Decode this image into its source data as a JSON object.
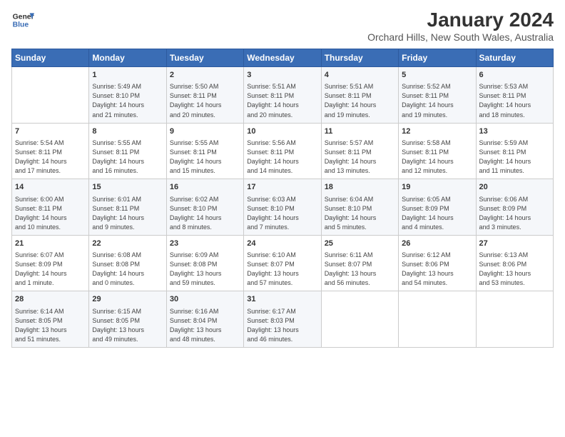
{
  "logo": {
    "line1": "General",
    "line2": "Blue"
  },
  "title": "January 2024",
  "subtitle": "Orchard Hills, New South Wales, Australia",
  "colors": {
    "header_bg": "#3a6db5",
    "header_text": "#ffffff"
  },
  "days_of_week": [
    "Sunday",
    "Monday",
    "Tuesday",
    "Wednesday",
    "Thursday",
    "Friday",
    "Saturday"
  ],
  "weeks": [
    [
      {
        "day": "",
        "content": ""
      },
      {
        "day": "1",
        "content": "Sunrise: 5:49 AM\nSunset: 8:10 PM\nDaylight: 14 hours\nand 21 minutes."
      },
      {
        "day": "2",
        "content": "Sunrise: 5:50 AM\nSunset: 8:11 PM\nDaylight: 14 hours\nand 20 minutes."
      },
      {
        "day": "3",
        "content": "Sunrise: 5:51 AM\nSunset: 8:11 PM\nDaylight: 14 hours\nand 20 minutes."
      },
      {
        "day": "4",
        "content": "Sunrise: 5:51 AM\nSunset: 8:11 PM\nDaylight: 14 hours\nand 19 minutes."
      },
      {
        "day": "5",
        "content": "Sunrise: 5:52 AM\nSunset: 8:11 PM\nDaylight: 14 hours\nand 19 minutes."
      },
      {
        "day": "6",
        "content": "Sunrise: 5:53 AM\nSunset: 8:11 PM\nDaylight: 14 hours\nand 18 minutes."
      }
    ],
    [
      {
        "day": "7",
        "content": "Sunrise: 5:54 AM\nSunset: 8:11 PM\nDaylight: 14 hours\nand 17 minutes."
      },
      {
        "day": "8",
        "content": "Sunrise: 5:55 AM\nSunset: 8:11 PM\nDaylight: 14 hours\nand 16 minutes."
      },
      {
        "day": "9",
        "content": "Sunrise: 5:55 AM\nSunset: 8:11 PM\nDaylight: 14 hours\nand 15 minutes."
      },
      {
        "day": "10",
        "content": "Sunrise: 5:56 AM\nSunset: 8:11 PM\nDaylight: 14 hours\nand 14 minutes."
      },
      {
        "day": "11",
        "content": "Sunrise: 5:57 AM\nSunset: 8:11 PM\nDaylight: 14 hours\nand 13 minutes."
      },
      {
        "day": "12",
        "content": "Sunrise: 5:58 AM\nSunset: 8:11 PM\nDaylight: 14 hours\nand 12 minutes."
      },
      {
        "day": "13",
        "content": "Sunrise: 5:59 AM\nSunset: 8:11 PM\nDaylight: 14 hours\nand 11 minutes."
      }
    ],
    [
      {
        "day": "14",
        "content": "Sunrise: 6:00 AM\nSunset: 8:11 PM\nDaylight: 14 hours\nand 10 minutes."
      },
      {
        "day": "15",
        "content": "Sunrise: 6:01 AM\nSunset: 8:11 PM\nDaylight: 14 hours\nand 9 minutes."
      },
      {
        "day": "16",
        "content": "Sunrise: 6:02 AM\nSunset: 8:10 PM\nDaylight: 14 hours\nand 8 minutes."
      },
      {
        "day": "17",
        "content": "Sunrise: 6:03 AM\nSunset: 8:10 PM\nDaylight: 14 hours\nand 7 minutes."
      },
      {
        "day": "18",
        "content": "Sunrise: 6:04 AM\nSunset: 8:10 PM\nDaylight: 14 hours\nand 5 minutes."
      },
      {
        "day": "19",
        "content": "Sunrise: 6:05 AM\nSunset: 8:09 PM\nDaylight: 14 hours\nand 4 minutes."
      },
      {
        "day": "20",
        "content": "Sunrise: 6:06 AM\nSunset: 8:09 PM\nDaylight: 14 hours\nand 3 minutes."
      }
    ],
    [
      {
        "day": "21",
        "content": "Sunrise: 6:07 AM\nSunset: 8:09 PM\nDaylight: 14 hours\nand 1 minute."
      },
      {
        "day": "22",
        "content": "Sunrise: 6:08 AM\nSunset: 8:08 PM\nDaylight: 14 hours\nand 0 minutes."
      },
      {
        "day": "23",
        "content": "Sunrise: 6:09 AM\nSunset: 8:08 PM\nDaylight: 13 hours\nand 59 minutes."
      },
      {
        "day": "24",
        "content": "Sunrise: 6:10 AM\nSunset: 8:07 PM\nDaylight: 13 hours\nand 57 minutes."
      },
      {
        "day": "25",
        "content": "Sunrise: 6:11 AM\nSunset: 8:07 PM\nDaylight: 13 hours\nand 56 minutes."
      },
      {
        "day": "26",
        "content": "Sunrise: 6:12 AM\nSunset: 8:06 PM\nDaylight: 13 hours\nand 54 minutes."
      },
      {
        "day": "27",
        "content": "Sunrise: 6:13 AM\nSunset: 8:06 PM\nDaylight: 13 hours\nand 53 minutes."
      }
    ],
    [
      {
        "day": "28",
        "content": "Sunrise: 6:14 AM\nSunset: 8:05 PM\nDaylight: 13 hours\nand 51 minutes."
      },
      {
        "day": "29",
        "content": "Sunrise: 6:15 AM\nSunset: 8:05 PM\nDaylight: 13 hours\nand 49 minutes."
      },
      {
        "day": "30",
        "content": "Sunrise: 6:16 AM\nSunset: 8:04 PM\nDaylight: 13 hours\nand 48 minutes."
      },
      {
        "day": "31",
        "content": "Sunrise: 6:17 AM\nSunset: 8:03 PM\nDaylight: 13 hours\nand 46 minutes."
      },
      {
        "day": "",
        "content": ""
      },
      {
        "day": "",
        "content": ""
      },
      {
        "day": "",
        "content": ""
      }
    ]
  ]
}
